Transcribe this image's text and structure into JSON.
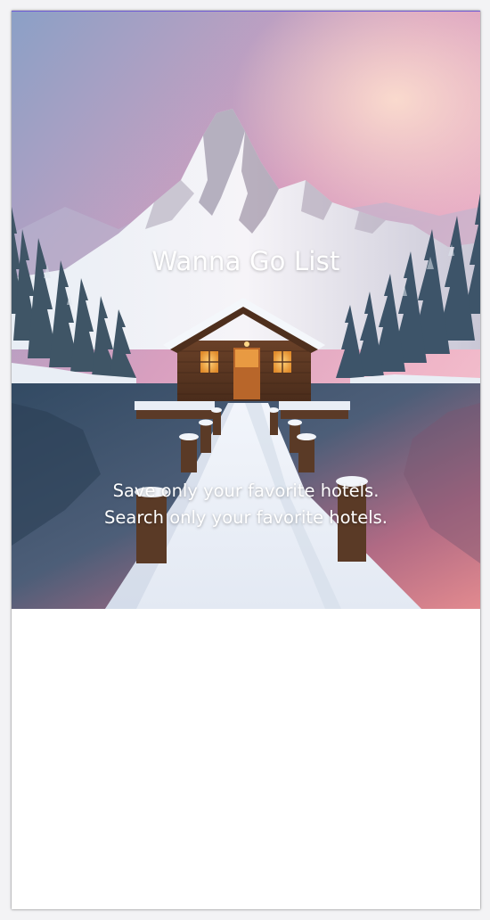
{
  "app": {
    "title": "Wanna Go List",
    "tagline_line1": "Save only your favorite hotels.",
    "tagline_line2": "Search only your favorite hotels."
  },
  "hero": {
    "image_subject": "snowy-cabin-on-lake-with-mountain",
    "sky_colors": [
      "#8ea3c4",
      "#e7a7c0",
      "#f6c3cf"
    ],
    "window_glow": "#f2a03a"
  }
}
